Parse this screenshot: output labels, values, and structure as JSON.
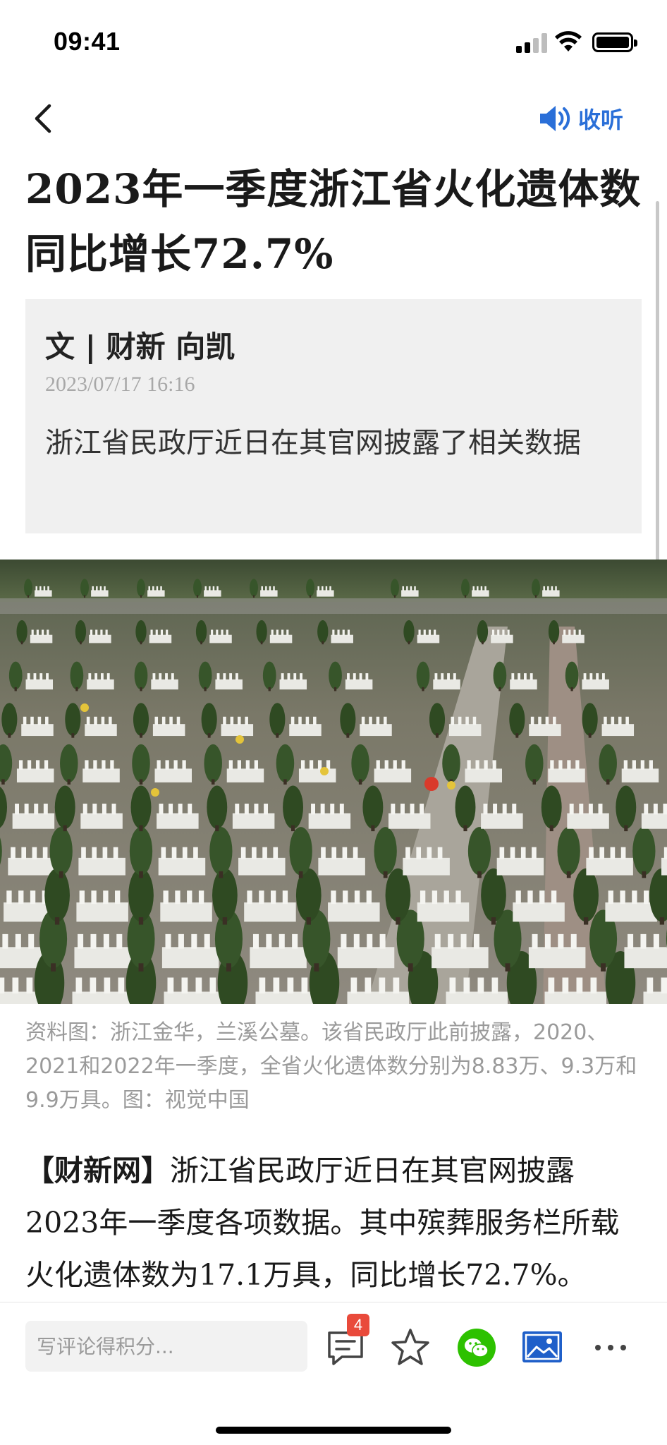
{
  "status_bar": {
    "time": "09:41"
  },
  "nav": {
    "listen_label": "收听"
  },
  "article": {
    "title": "2023年一季度浙江省火化遗体数同比增长72.7%",
    "byline": "文 | 财新 向凯",
    "date": "2023/07/17 16:16",
    "summary": "浙江省民政厅近日在其官网披露了相关数据",
    "image_caption": "资料图：浙江金华，兰溪公墓。该省民政厅此前披露，2020、2021和2022年一季度，全省火化遗体数分别为8.83万、9.3万和9.9万具。图：视觉中国",
    "body_source_tag": "【财新网】",
    "body_text": "浙江省民政厅近日在其官网披露2023年一季度各项数据。其中殡葬服务栏所载火化遗体数为17.1万具，同比增长72.7%。"
  },
  "toolbar": {
    "comment_placeholder": "写评论得积分...",
    "comment_count": "4"
  },
  "icons": {
    "back": "chevron-left-icon",
    "listen": "speaker-icon",
    "comment": "comment-icon",
    "favorite": "star-icon",
    "share_wechat": "wechat-icon",
    "gallery": "image-icon",
    "more": "more-icon"
  },
  "colors": {
    "accent": "#2a6fd8",
    "badge": "#e94a3b",
    "wechat": "#2dc100",
    "summary_bg": "#f0f0f0"
  }
}
